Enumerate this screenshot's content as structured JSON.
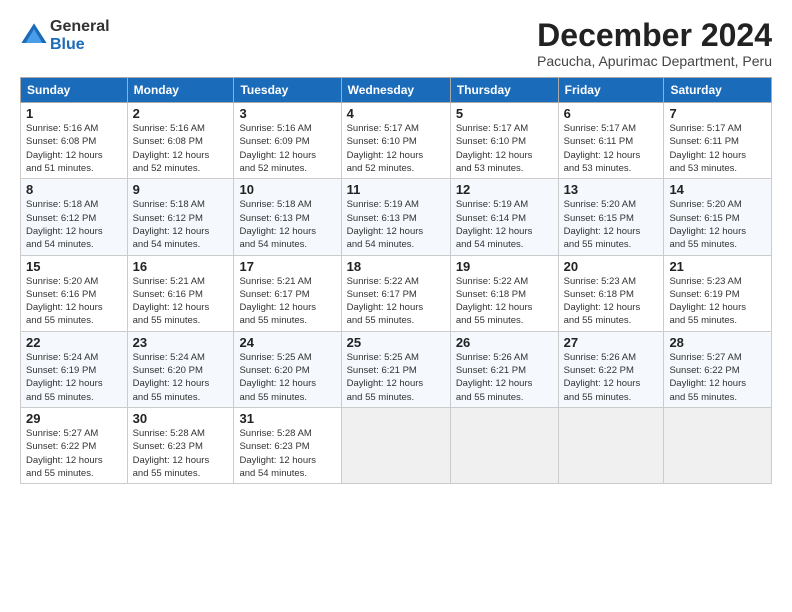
{
  "header": {
    "logo_general": "General",
    "logo_blue": "Blue",
    "title": "December 2024",
    "subtitle": "Pacucha, Apurimac Department, Peru"
  },
  "calendar": {
    "headers": [
      "Sunday",
      "Monday",
      "Tuesday",
      "Wednesday",
      "Thursday",
      "Friday",
      "Saturday"
    ],
    "weeks": [
      [
        {
          "day": "",
          "info": ""
        },
        {
          "day": "2",
          "info": "Sunrise: 5:16 AM\nSunset: 6:08 PM\nDaylight: 12 hours\nand 52 minutes."
        },
        {
          "day": "3",
          "info": "Sunrise: 5:16 AM\nSunset: 6:09 PM\nDaylight: 12 hours\nand 52 minutes."
        },
        {
          "day": "4",
          "info": "Sunrise: 5:17 AM\nSunset: 6:10 PM\nDaylight: 12 hours\nand 52 minutes."
        },
        {
          "day": "5",
          "info": "Sunrise: 5:17 AM\nSunset: 6:10 PM\nDaylight: 12 hours\nand 53 minutes."
        },
        {
          "day": "6",
          "info": "Sunrise: 5:17 AM\nSunset: 6:11 PM\nDaylight: 12 hours\nand 53 minutes."
        },
        {
          "day": "7",
          "info": "Sunrise: 5:17 AM\nSunset: 6:11 PM\nDaylight: 12 hours\nand 53 minutes."
        }
      ],
      [
        {
          "day": "8",
          "info": "Sunrise: 5:18 AM\nSunset: 6:12 PM\nDaylight: 12 hours\nand 54 minutes."
        },
        {
          "day": "9",
          "info": "Sunrise: 5:18 AM\nSunset: 6:12 PM\nDaylight: 12 hours\nand 54 minutes."
        },
        {
          "day": "10",
          "info": "Sunrise: 5:18 AM\nSunset: 6:13 PM\nDaylight: 12 hours\nand 54 minutes."
        },
        {
          "day": "11",
          "info": "Sunrise: 5:19 AM\nSunset: 6:13 PM\nDaylight: 12 hours\nand 54 minutes."
        },
        {
          "day": "12",
          "info": "Sunrise: 5:19 AM\nSunset: 6:14 PM\nDaylight: 12 hours\nand 54 minutes."
        },
        {
          "day": "13",
          "info": "Sunrise: 5:20 AM\nSunset: 6:15 PM\nDaylight: 12 hours\nand 55 minutes."
        },
        {
          "day": "14",
          "info": "Sunrise: 5:20 AM\nSunset: 6:15 PM\nDaylight: 12 hours\nand 55 minutes."
        }
      ],
      [
        {
          "day": "15",
          "info": "Sunrise: 5:20 AM\nSunset: 6:16 PM\nDaylight: 12 hours\nand 55 minutes."
        },
        {
          "day": "16",
          "info": "Sunrise: 5:21 AM\nSunset: 6:16 PM\nDaylight: 12 hours\nand 55 minutes."
        },
        {
          "day": "17",
          "info": "Sunrise: 5:21 AM\nSunset: 6:17 PM\nDaylight: 12 hours\nand 55 minutes."
        },
        {
          "day": "18",
          "info": "Sunrise: 5:22 AM\nSunset: 6:17 PM\nDaylight: 12 hours\nand 55 minutes."
        },
        {
          "day": "19",
          "info": "Sunrise: 5:22 AM\nSunset: 6:18 PM\nDaylight: 12 hours\nand 55 minutes."
        },
        {
          "day": "20",
          "info": "Sunrise: 5:23 AM\nSunset: 6:18 PM\nDaylight: 12 hours\nand 55 minutes."
        },
        {
          "day": "21",
          "info": "Sunrise: 5:23 AM\nSunset: 6:19 PM\nDaylight: 12 hours\nand 55 minutes."
        }
      ],
      [
        {
          "day": "22",
          "info": "Sunrise: 5:24 AM\nSunset: 6:19 PM\nDaylight: 12 hours\nand 55 minutes."
        },
        {
          "day": "23",
          "info": "Sunrise: 5:24 AM\nSunset: 6:20 PM\nDaylight: 12 hours\nand 55 minutes."
        },
        {
          "day": "24",
          "info": "Sunrise: 5:25 AM\nSunset: 6:20 PM\nDaylight: 12 hours\nand 55 minutes."
        },
        {
          "day": "25",
          "info": "Sunrise: 5:25 AM\nSunset: 6:21 PM\nDaylight: 12 hours\nand 55 minutes."
        },
        {
          "day": "26",
          "info": "Sunrise: 5:26 AM\nSunset: 6:21 PM\nDaylight: 12 hours\nand 55 minutes."
        },
        {
          "day": "27",
          "info": "Sunrise: 5:26 AM\nSunset: 6:22 PM\nDaylight: 12 hours\nand 55 minutes."
        },
        {
          "day": "28",
          "info": "Sunrise: 5:27 AM\nSunset: 6:22 PM\nDaylight: 12 hours\nand 55 minutes."
        }
      ],
      [
        {
          "day": "29",
          "info": "Sunrise: 5:27 AM\nSunset: 6:22 PM\nDaylight: 12 hours\nand 55 minutes."
        },
        {
          "day": "30",
          "info": "Sunrise: 5:28 AM\nSunset: 6:23 PM\nDaylight: 12 hours\nand 55 minutes."
        },
        {
          "day": "31",
          "info": "Sunrise: 5:28 AM\nSunset: 6:23 PM\nDaylight: 12 hours\nand 54 minutes."
        },
        {
          "day": "",
          "info": ""
        },
        {
          "day": "",
          "info": ""
        },
        {
          "day": "",
          "info": ""
        },
        {
          "day": "",
          "info": ""
        }
      ]
    ],
    "week1_day1": {
      "day": "1",
      "info": "Sunrise: 5:16 AM\nSunset: 6:08 PM\nDaylight: 12 hours\nand 51 minutes."
    }
  }
}
